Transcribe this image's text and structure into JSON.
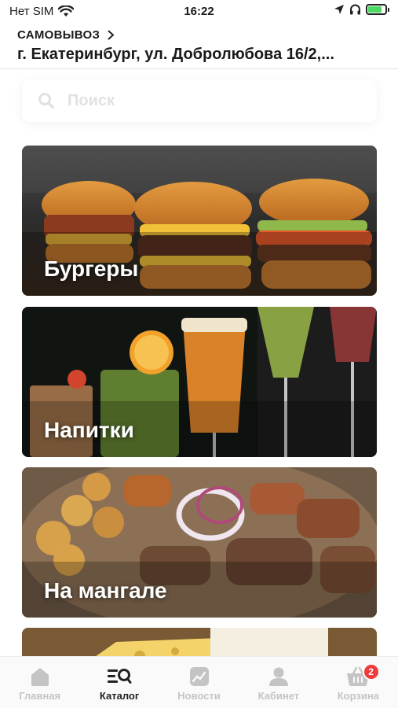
{
  "status_bar": {
    "carrier": "Нет SIM",
    "time": "16:22"
  },
  "header": {
    "delivery_mode": "САМОВЫВОЗ",
    "address": "г. Екатеринбург, ул. Добролюбова 16/2,..."
  },
  "search": {
    "placeholder": "Поиск"
  },
  "categories": [
    {
      "title": "Бургеры"
    },
    {
      "title": "Напитки"
    },
    {
      "title": "На мангале"
    },
    {
      "title": ""
    }
  ],
  "tabbar": {
    "items": [
      {
        "label": "Главная",
        "icon": "home-icon"
      },
      {
        "label": "Каталог",
        "icon": "catalog-icon"
      },
      {
        "label": "Новости",
        "icon": "news-icon"
      },
      {
        "label": "Кабинет",
        "icon": "profile-icon"
      },
      {
        "label": "Корзина",
        "icon": "basket-icon"
      }
    ],
    "cart_badge": "2"
  },
  "colors": {
    "accent": "#ef3b3b",
    "active_tab": "#222222",
    "inactive_tab": "#c4c4c4"
  }
}
